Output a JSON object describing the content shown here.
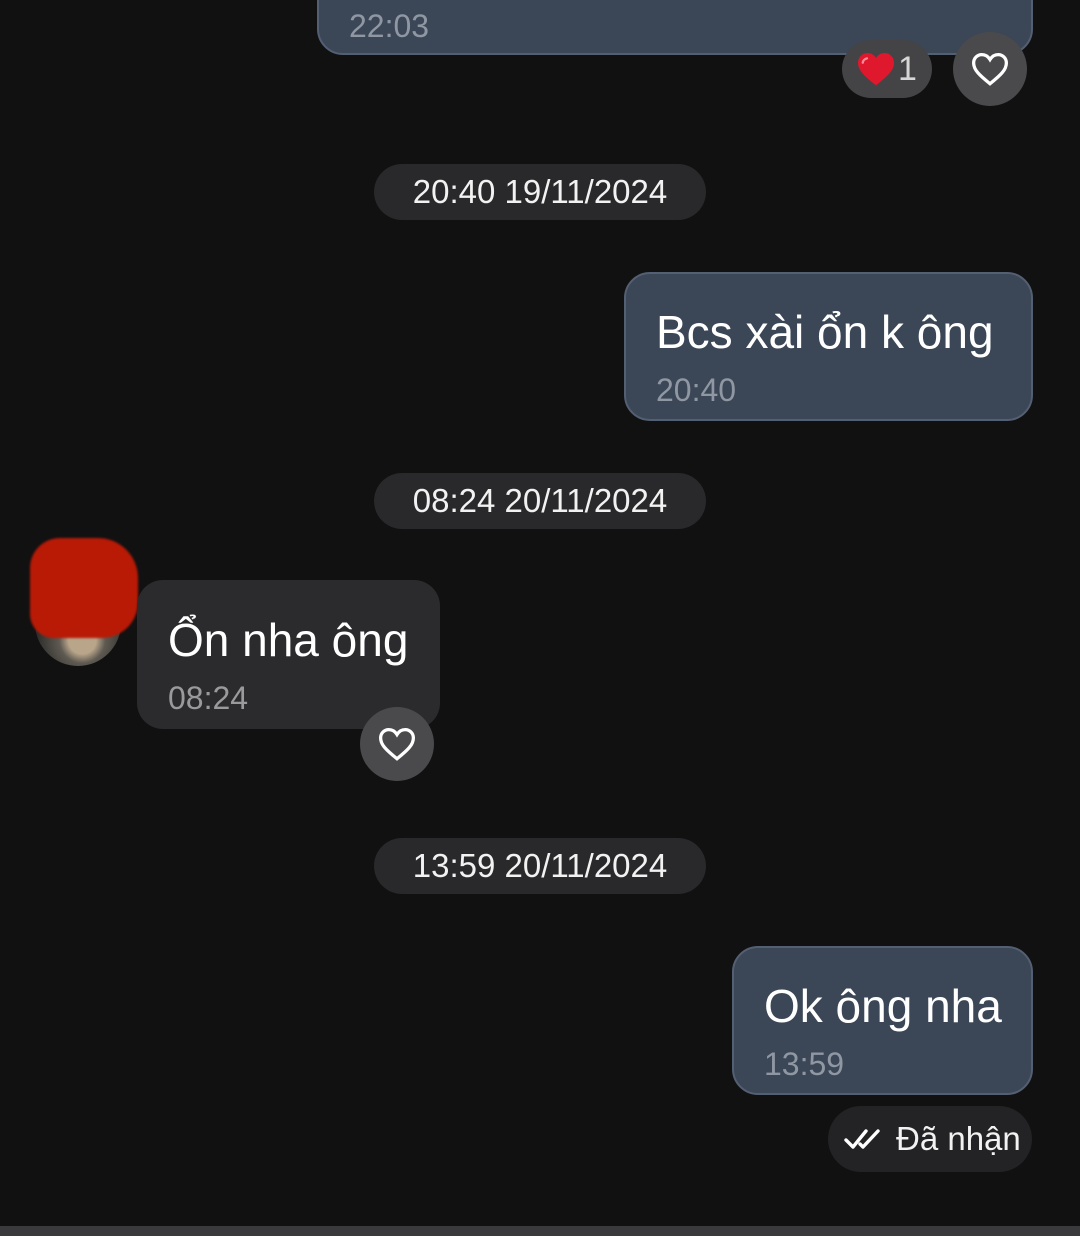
{
  "colors": {
    "background": "#111112",
    "outgoing_bubble": "#3b4656",
    "incoming_bubble": "#2b2b2d",
    "date_pill": "#29292b",
    "heart_red": "#e0182d",
    "redaction": "#b81a06"
  },
  "messages": [
    {
      "direction": "outgoing",
      "text": "",
      "time": "22:03",
      "reaction": {
        "icon": "red-heart-icon",
        "count": "1"
      }
    },
    {
      "direction": "outgoing",
      "text": "Bcs xài ổn k ông",
      "time": "20:40"
    },
    {
      "direction": "incoming",
      "text": "Ổn nha ông",
      "time": "08:24"
    },
    {
      "direction": "outgoing",
      "text": "Ok ông nha",
      "time": "13:59"
    }
  ],
  "date_separators": [
    "20:40 19/11/2024",
    "08:24 20/11/2024",
    "13:59 20/11/2024"
  ],
  "status": {
    "icon": "double-check-icon",
    "label": "Đã nhận"
  }
}
